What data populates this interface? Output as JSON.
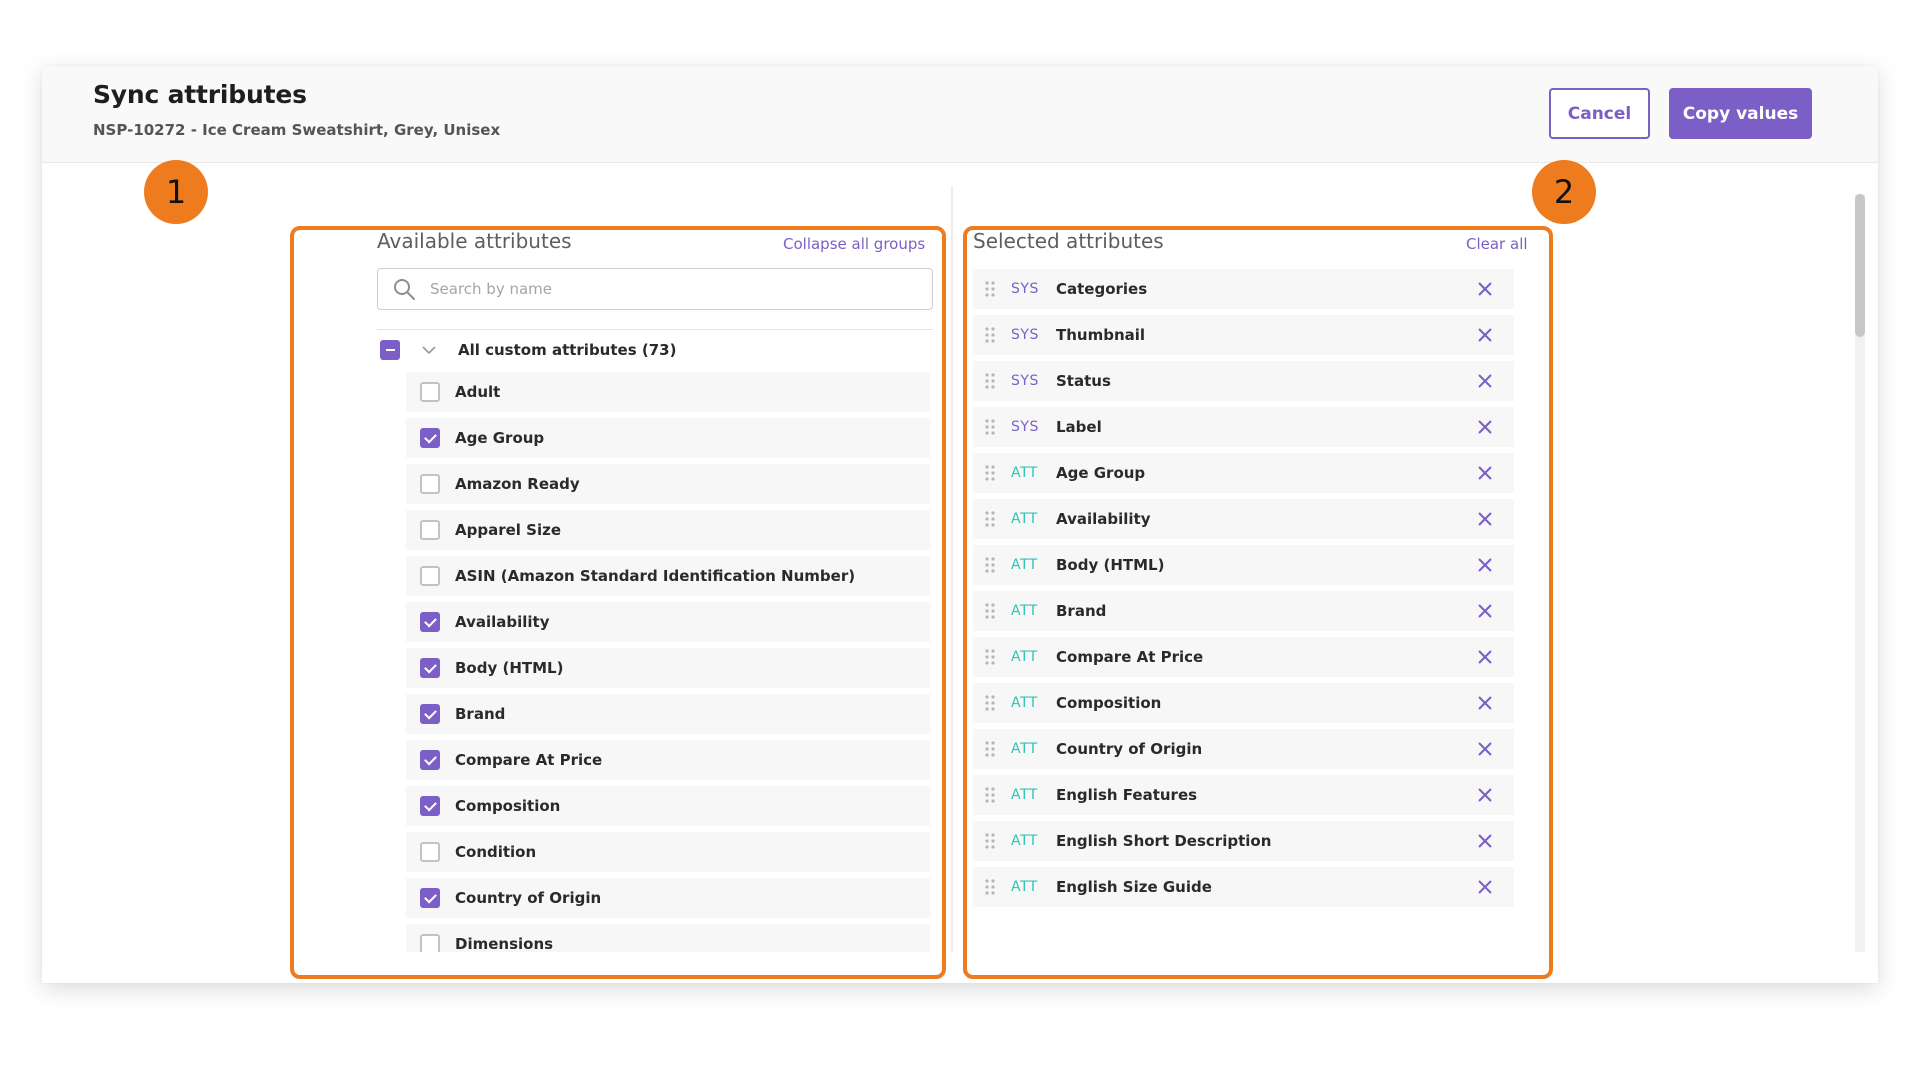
{
  "header": {
    "title": "Sync attributes",
    "subtitle": "NSP-10272 - Ice Cream Sweatshirt, Grey, Unisex",
    "cancel_label": "Cancel",
    "copy_label": "Copy values"
  },
  "callouts": {
    "left": "1",
    "right": "2"
  },
  "available": {
    "title": "Available attributes",
    "collapse_label": "Collapse all groups",
    "search_placeholder": "Search by name",
    "group_label": "All custom attributes (73)",
    "items": [
      {
        "label": "Adult",
        "checked": false
      },
      {
        "label": "Age Group",
        "checked": true
      },
      {
        "label": "Amazon Ready",
        "checked": false
      },
      {
        "label": "Apparel Size",
        "checked": false
      },
      {
        "label": "ASIN (Amazon Standard Identification Number)",
        "checked": false
      },
      {
        "label": "Availability",
        "checked": true
      },
      {
        "label": "Body (HTML)",
        "checked": true
      },
      {
        "label": "Brand",
        "checked": true
      },
      {
        "label": "Compare At Price",
        "checked": true
      },
      {
        "label": "Composition",
        "checked": true
      },
      {
        "label": "Condition",
        "checked": false
      },
      {
        "label": "Country of Origin",
        "checked": true
      },
      {
        "label": "Dimensions",
        "checked": false
      }
    ]
  },
  "selected": {
    "title": "Selected attributes",
    "clear_label": "Clear all",
    "items": [
      {
        "type": "SYS",
        "label": "Categories"
      },
      {
        "type": "SYS",
        "label": "Thumbnail"
      },
      {
        "type": "SYS",
        "label": "Status"
      },
      {
        "type": "SYS",
        "label": "Label"
      },
      {
        "type": "ATT",
        "label": "Age Group"
      },
      {
        "type": "ATT",
        "label": "Availability"
      },
      {
        "type": "ATT",
        "label": "Body (HTML)"
      },
      {
        "type": "ATT",
        "label": "Brand"
      },
      {
        "type": "ATT",
        "label": "Compare At Price"
      },
      {
        "type": "ATT",
        "label": "Composition"
      },
      {
        "type": "ATT",
        "label": "Country of Origin"
      },
      {
        "type": "ATT",
        "label": "English Features"
      },
      {
        "type": "ATT",
        "label": "English Short Description"
      },
      {
        "type": "ATT",
        "label": "English Size Guide"
      }
    ]
  },
  "icons": {
    "search": "search-icon",
    "chevron": "chevron-down-icon",
    "drag": "drag-handle-icon",
    "remove": "close-icon"
  },
  "colors": {
    "accent": "#7b5fc7",
    "sys_tag": "#7b5fc7",
    "att_tag": "#2ec4b6",
    "callout": "#ee7b1e"
  }
}
